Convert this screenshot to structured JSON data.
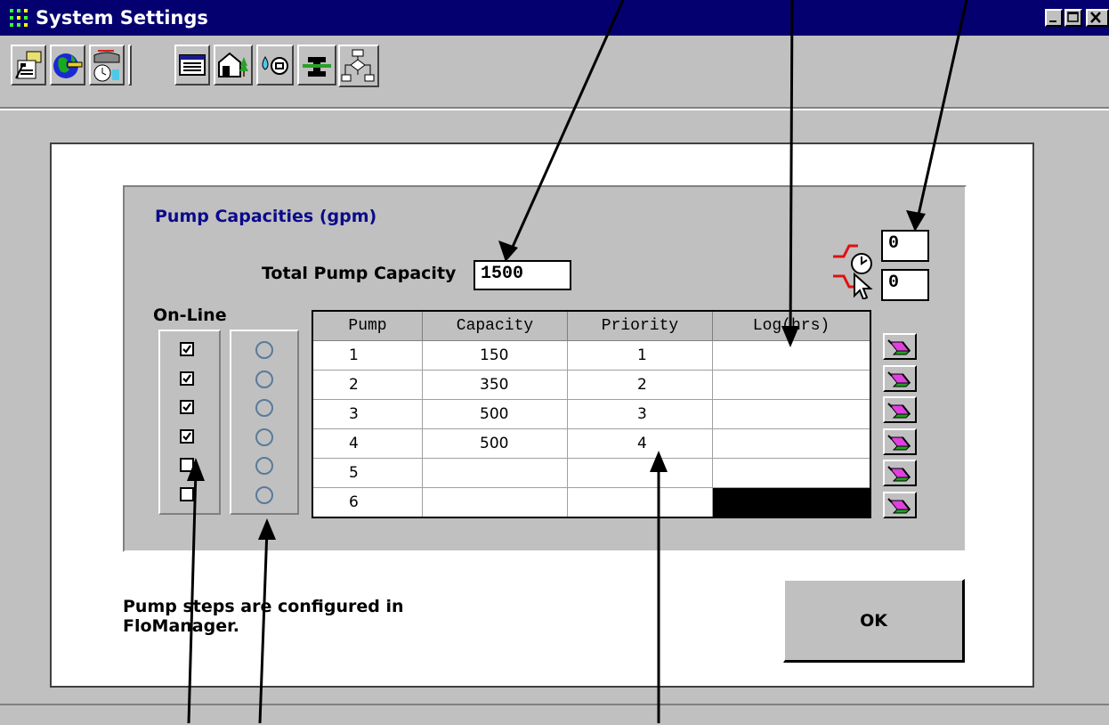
{
  "window": {
    "title": "System Settings"
  },
  "toolbar": {
    "icons": [
      "controller-icon",
      "globe-ruler-icon",
      "flow-meter-clock-icon",
      "table-icon",
      "house-tree-icon",
      "water-drop-icon",
      "pipe-icon",
      "flowchart-icon"
    ]
  },
  "group": {
    "title": "Pump Capacities (gpm)",
    "total_label": "Total Pump Capacity",
    "total_value": "1500",
    "delay_top": "0",
    "delay_bottom": "0",
    "online_label": "On-Line"
  },
  "table": {
    "headers": [
      "Pump",
      "Capacity",
      "Priority",
      "Log(hrs)"
    ],
    "rows": [
      {
        "pump": "1",
        "capacity": "150",
        "priority": "1",
        "log": ""
      },
      {
        "pump": "2",
        "capacity": "350",
        "priority": "2",
        "log": ""
      },
      {
        "pump": "3",
        "capacity": "500",
        "priority": "3",
        "log": ""
      },
      {
        "pump": "4",
        "capacity": "500",
        "priority": "4",
        "log": ""
      },
      {
        "pump": "5",
        "capacity": "",
        "priority": "",
        "log": ""
      },
      {
        "pump": "6",
        "capacity": "",
        "priority": "",
        "log": ""
      }
    ],
    "online_checked": [
      true,
      true,
      true,
      true,
      false,
      false
    ]
  },
  "note": {
    "line1": "Pump steps are configured in",
    "line2": "FloManager."
  },
  "ok_label": "OK",
  "colors": {
    "titlebar": "#05006f",
    "face": "#c0c0c0",
    "group_title": "#0a0a8a"
  }
}
